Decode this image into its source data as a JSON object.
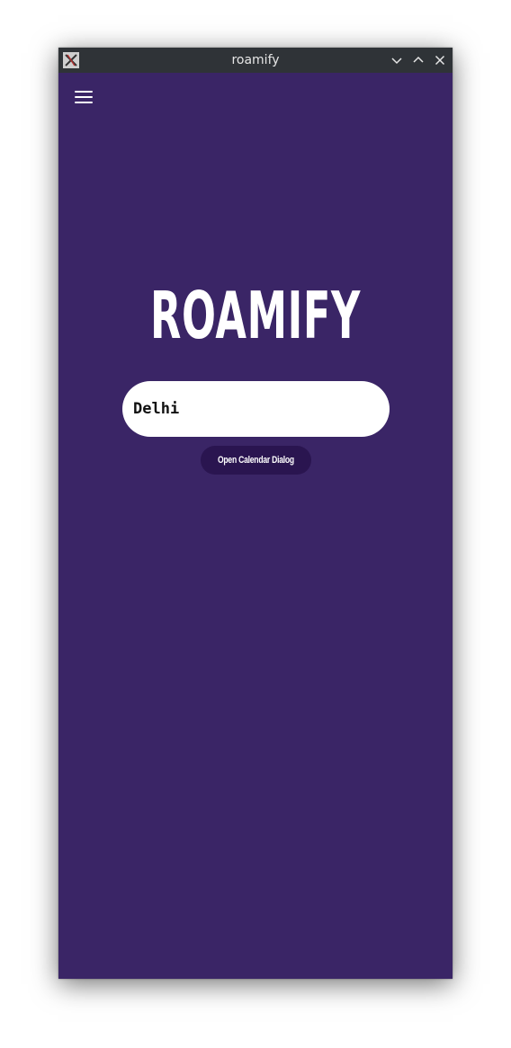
{
  "window": {
    "title": "roamify"
  },
  "titlebar": {
    "icons": [
      "app-icon",
      "minimize-icon",
      "maximize-icon",
      "close-icon"
    ]
  },
  "header": {
    "menu_icon": "hamburger-menu-icon"
  },
  "main": {
    "brand_title": "ROAMIFY",
    "search": {
      "value": "Delhi",
      "placeholder": ""
    },
    "calendar_button_label": "Open Calendar Dialog"
  },
  "colors": {
    "background": "#3a2566",
    "titlebar": "#2f3337",
    "button": "#2a1550",
    "field": "#ffffff",
    "text_light": "#ffffff"
  }
}
